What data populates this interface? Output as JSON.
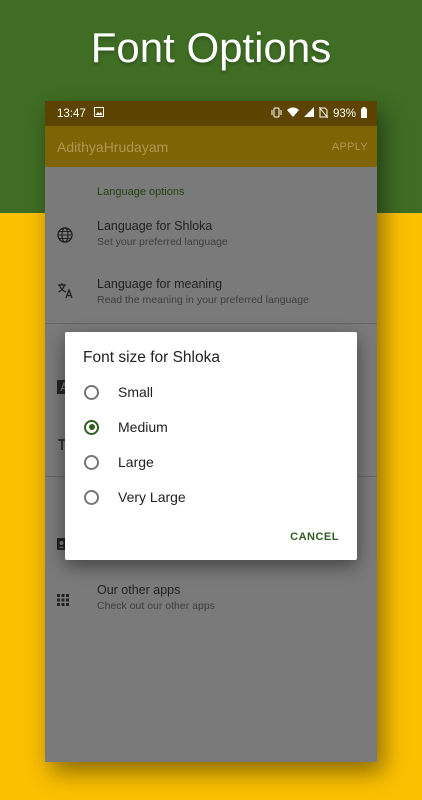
{
  "promo": {
    "title": "Font Options"
  },
  "status": {
    "time": "13:47",
    "battery": "93%"
  },
  "appbar": {
    "title": "AdithyaHrudayam",
    "apply_label": "APPLY"
  },
  "settings": {
    "section_header": "Language options",
    "items": [
      {
        "title": "Language for Shloka",
        "subtitle": "Set your preferred language",
        "icon": "globe-icon"
      },
      {
        "title": "Language for meaning",
        "subtitle": "Read the meaning in your preferred language",
        "icon": "translate-icon"
      }
    ],
    "bottom_item": {
      "title": "Our other apps",
      "subtitle": "Check out our other apps",
      "icon": "apps-grid-icon"
    }
  },
  "dialog": {
    "title": "Font size for Shloka",
    "options": [
      "Small",
      "Medium",
      "Large",
      "Very Large"
    ],
    "selected": "Medium",
    "cancel_label": "CANCEL"
  },
  "colors": {
    "accent": "#2f5e1e",
    "banner_green": "#3f6d24",
    "banner_yellow": "#fbc000"
  }
}
